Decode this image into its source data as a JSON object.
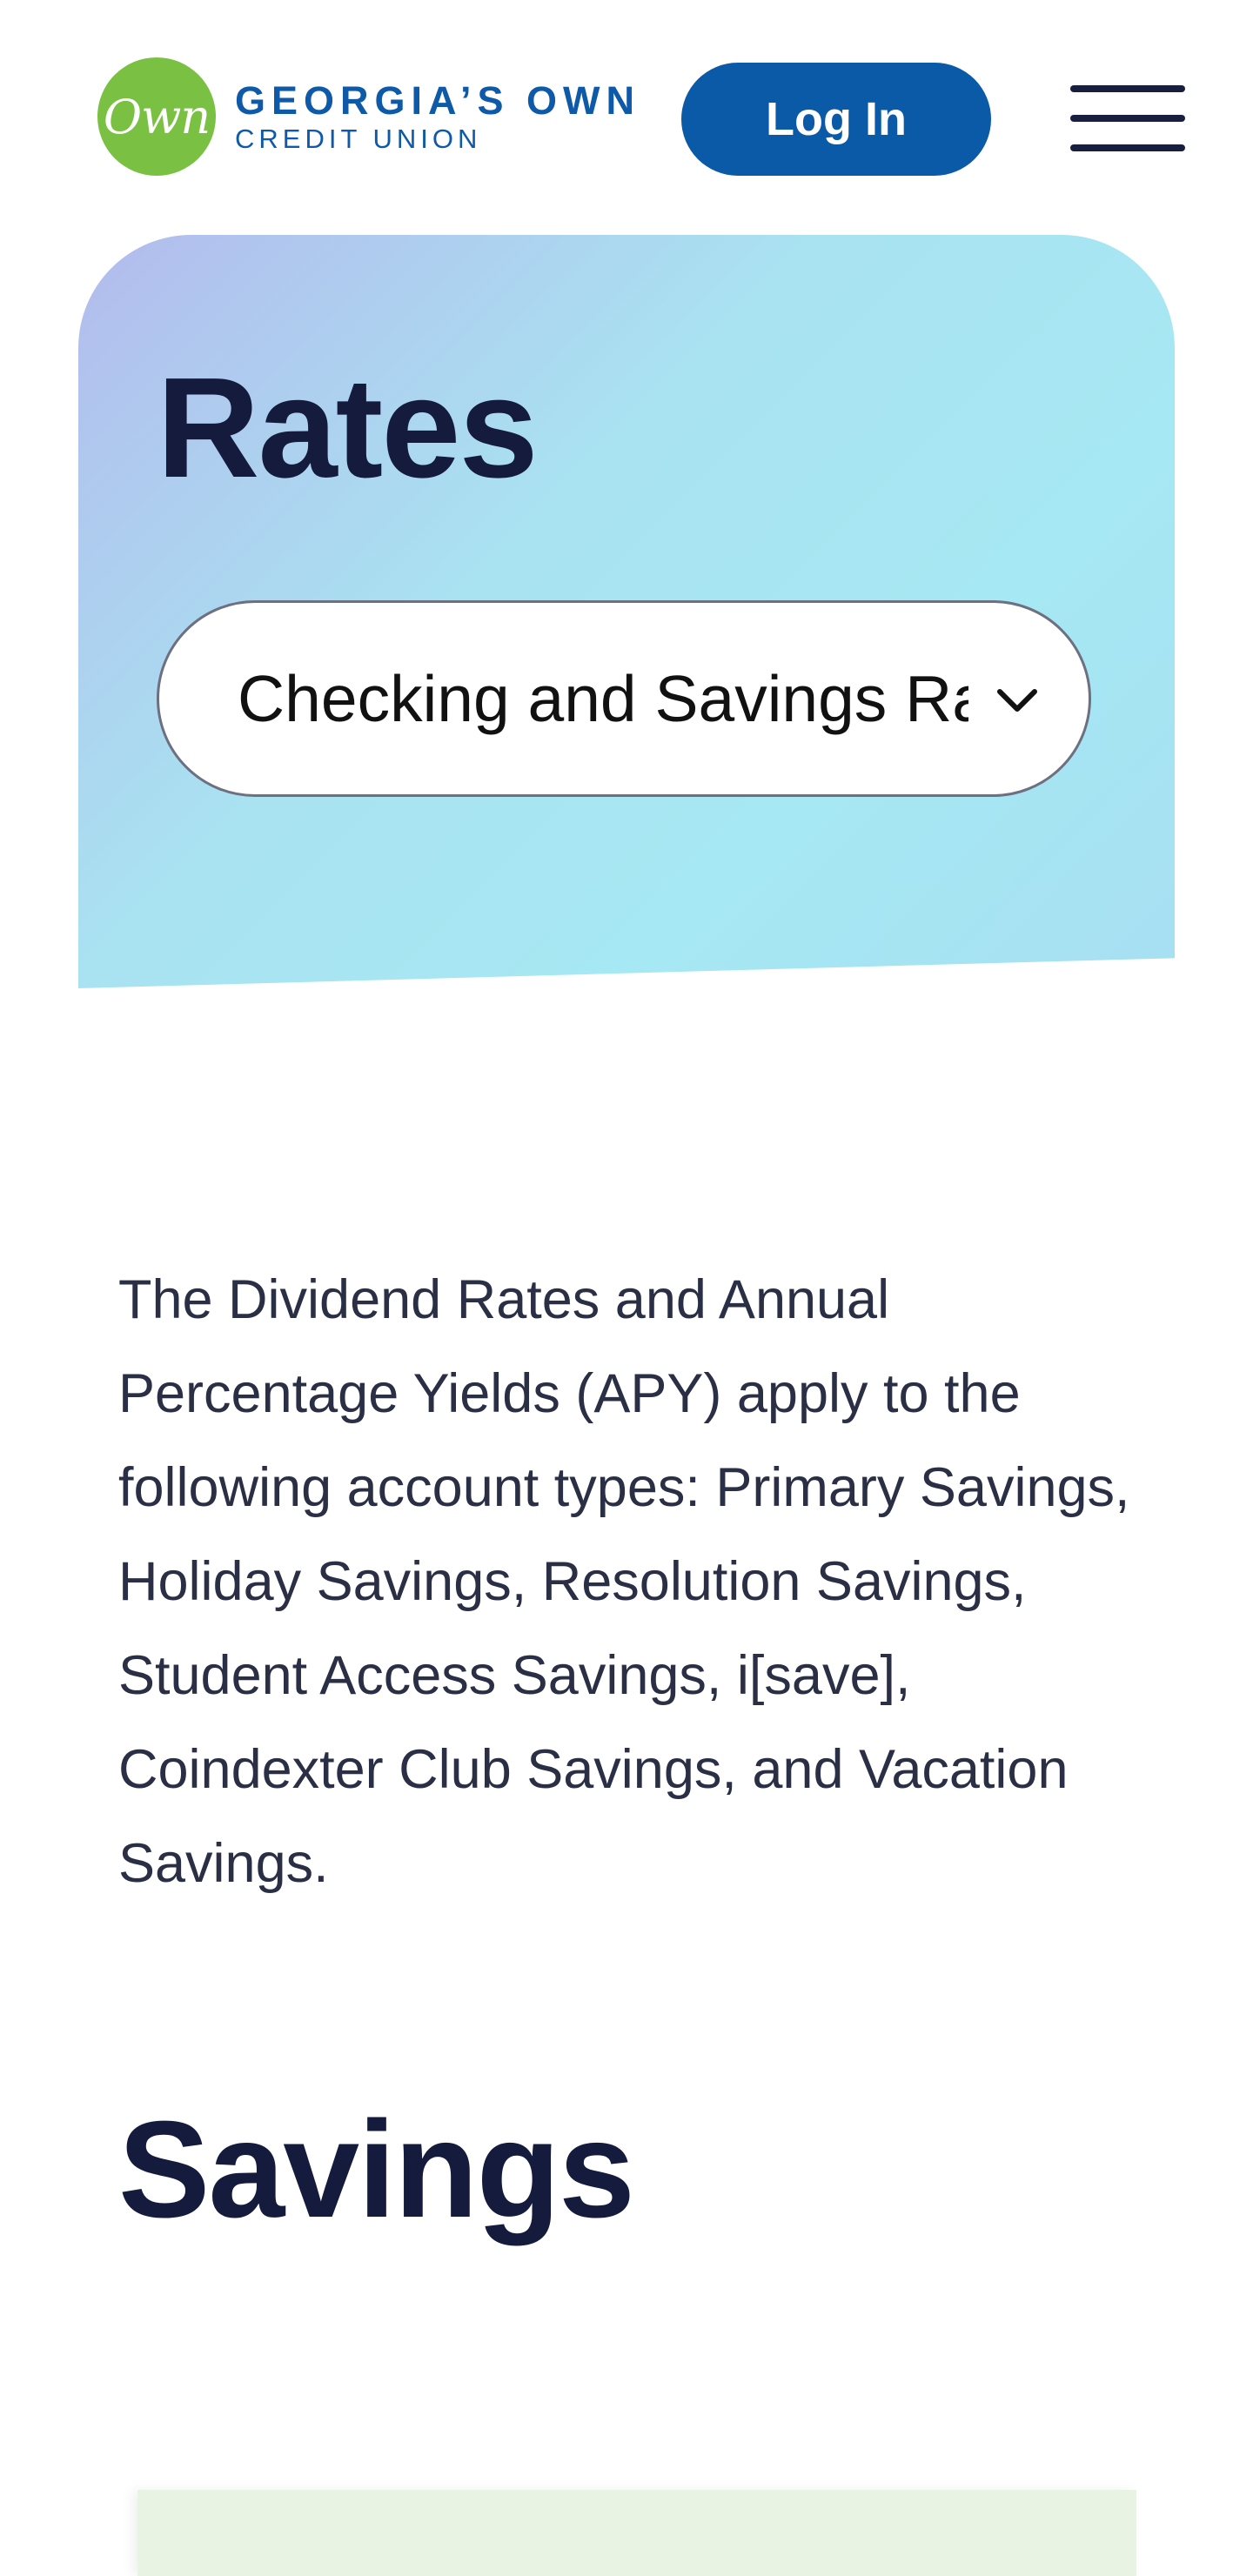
{
  "header": {
    "logo_mark": "Own",
    "logo_line1": "GEORGIA’S OWN",
    "logo_line2": "CREDIT UNION",
    "login_label": "Log In"
  },
  "hero": {
    "title": "Rates",
    "select_value": "Checking and Savings Rates"
  },
  "intro_text": "The Dividend Rates and Annual Percentage Yields (APY) apply to the following account types: Primary Savings, Holiday Savings, Resolution Savings, Student Access Savings, i[save], Coindexter Club Savings, and Vacation Savings.",
  "section": {
    "heading": "Savings"
  },
  "colors": {
    "brand_blue": "#0a5aa7",
    "logo_green": "#7ac143",
    "heading_navy": "#151b3d",
    "panel_green": "#e9f3e4"
  },
  "icons": {
    "menu": "hamburger-menu-icon",
    "select": "chevron-down-icon"
  }
}
